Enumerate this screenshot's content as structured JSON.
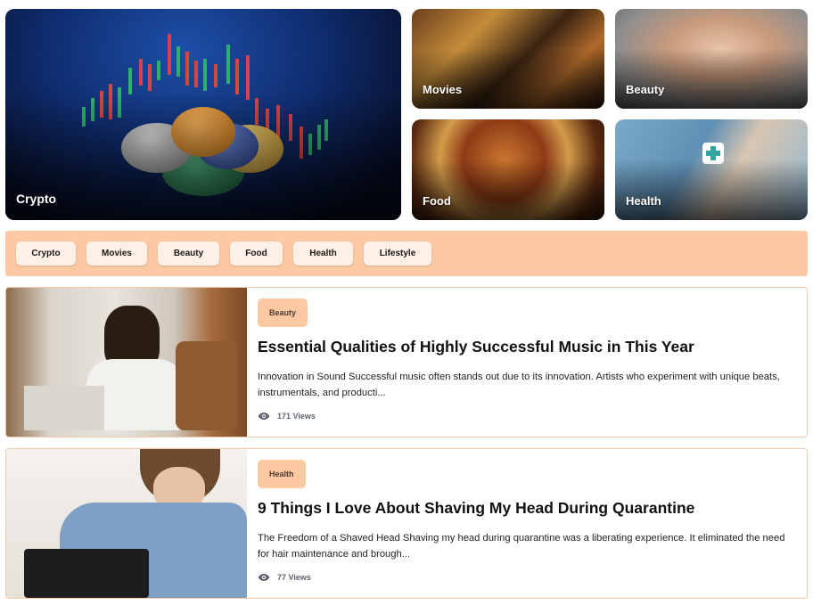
{
  "tiles": {
    "crypto": "Crypto",
    "movies": "Movies",
    "beauty": "Beauty",
    "food": "Food",
    "health": "Health"
  },
  "filters": [
    "Crypto",
    "Movies",
    "Beauty",
    "Food",
    "Health",
    "Lifestyle"
  ],
  "articles": [
    {
      "category": "Beauty",
      "title": "Essential Qualities of Highly Successful Music in This Year",
      "excerpt": "Innovation in Sound Successful music often stands out due to its innovation. Artists who experiment with unique beats, instrumentals, and producti...",
      "views": "171 Views"
    },
    {
      "category": "Health",
      "title": "9 Things I Love About Shaving My Head During Quarantine",
      "excerpt": "The Freedom of a Shaved Head Shaving my head during quarantine was a liberating experience. It eliminated the need for hair maintenance and brough...",
      "views": "77 Views"
    }
  ],
  "colors": {
    "accent": "#fcc9a3",
    "chip_bg": "#fdf0e6",
    "card_border": "#f2c9a8"
  },
  "icons": {
    "views": "eye-icon"
  }
}
